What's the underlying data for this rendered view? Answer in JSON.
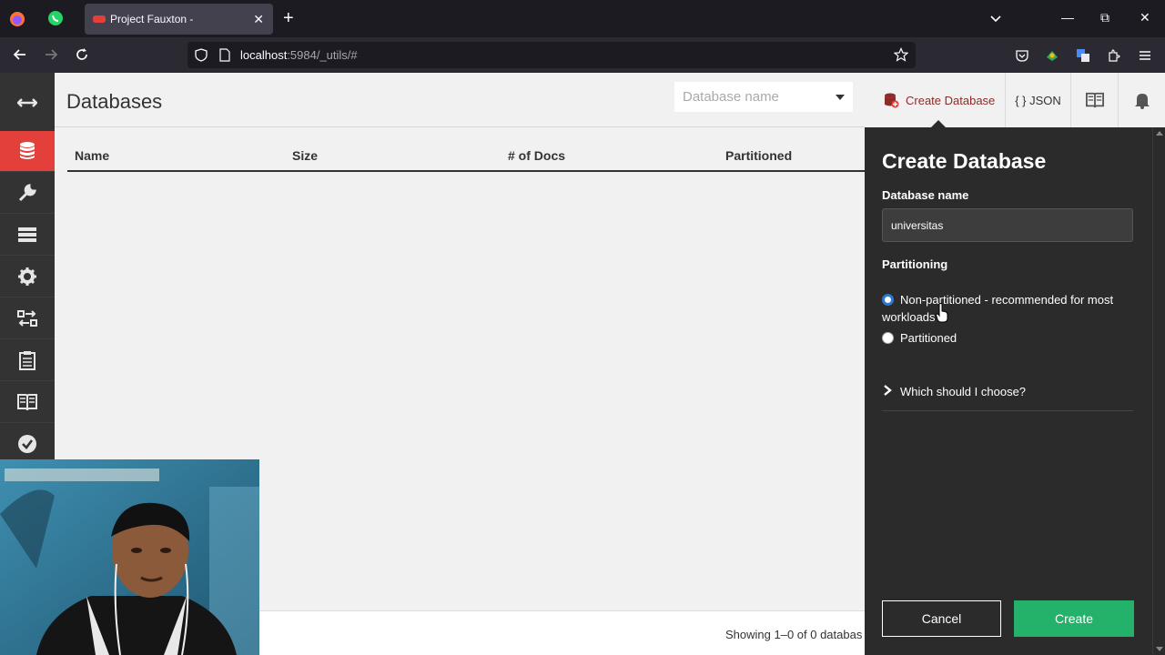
{
  "browser": {
    "tab_title": "Project Fauxton -",
    "url_host": "localhost",
    "url_rest": ":5984/_utils/#"
  },
  "sidenav": {
    "items": [
      {
        "icon": "expand-arrows-icon"
      },
      {
        "icon": "database-icon",
        "active": true
      },
      {
        "icon": "wrench-icon"
      },
      {
        "icon": "server-icon"
      },
      {
        "icon": "gear-icon"
      },
      {
        "icon": "replication-icon"
      },
      {
        "icon": "clipboard-icon"
      },
      {
        "icon": "book-icon"
      },
      {
        "icon": "check-circle-icon"
      }
    ]
  },
  "header": {
    "title": "Databases",
    "search_placeholder": "Database name",
    "create_label": "Create Database",
    "json_label": "{ } JSON"
  },
  "table": {
    "columns": [
      "Name",
      "Size",
      "# of Docs",
      "Partitioned"
    ]
  },
  "footer": {
    "showing": "Showing 1–0 of 0 databas"
  },
  "tray": {
    "title": "Create Database",
    "name_label": "Database name",
    "name_value": "universitas",
    "partitioning_label": "Partitioning",
    "option_non_partitioned": "Non-partitioned - recommended for most workloads",
    "option_partitioned": "Partitioned",
    "which_label": "Which should I choose?",
    "cancel_label": "Cancel",
    "create_label": "Create"
  },
  "colors": {
    "accent_red": "#e33f3b",
    "create_green": "#24b26b",
    "tray_bg": "#2b2b2b"
  }
}
